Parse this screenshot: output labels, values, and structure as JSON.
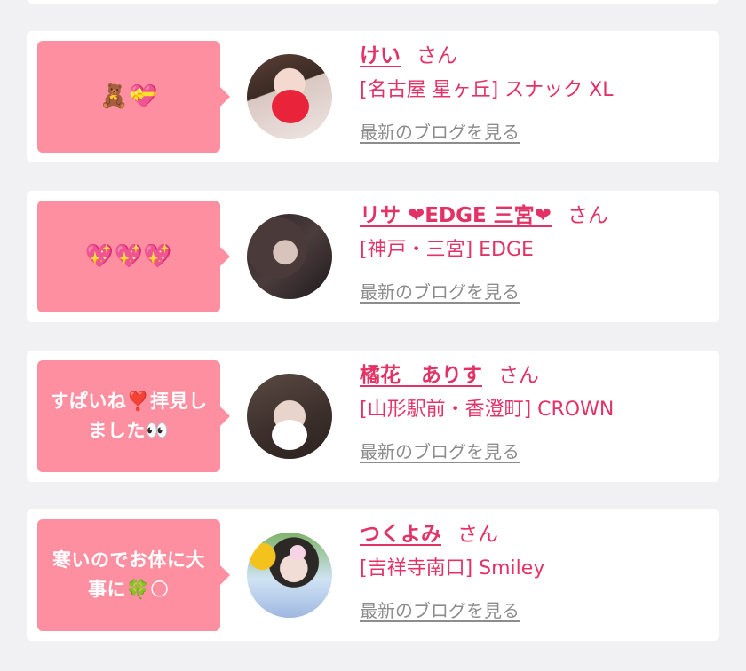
{
  "entries": [
    {
      "message": "🧸💝",
      "name": "けい",
      "suffix": "さん",
      "shop": "[名古屋 星ヶ丘] スナック XL",
      "blog_link": "最新のブログを見る"
    },
    {
      "message": "💖💖💖",
      "name": "リサ ❤EDGE 三宮❤",
      "suffix": "さん",
      "shop": "[神戸・三宮] EDGE",
      "blog_link": "最新のブログを見る"
    },
    {
      "message_line1": "すぱいね❣️拝見し",
      "message_line2": "ました👀",
      "name": "橘花　ありす",
      "suffix": "さん",
      "shop": "[山形駅前・香澄町] CROWN",
      "blog_link": "最新のブログを見る"
    },
    {
      "message_line1": "寒いのでお体に大",
      "message_line2": "事に🍀🌕",
      "name": "つくよみ",
      "suffix": "さん",
      "shop": "[吉祥寺南口] Smiley",
      "blog_link": "最新のブログを見る"
    }
  ],
  "colors": {
    "page_background": "#f1f1f3",
    "card_background": "#ffffff",
    "bubble": "#fd8fa0",
    "name_text": "#e33265",
    "blog_link_text": "#8d8d8d"
  },
  "icons": [
    "avatar-photo-kei",
    "avatar-photo-risa",
    "avatar-photo-arisu",
    "avatar-photo-tsukuyomi"
  ]
}
